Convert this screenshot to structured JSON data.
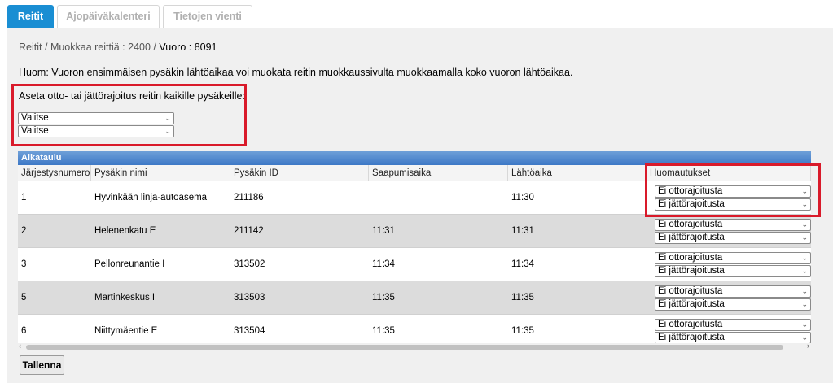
{
  "tabs": [
    {
      "label": "Reitit",
      "active": true
    },
    {
      "label": "Ajopäiväkalenteri",
      "active": false
    },
    {
      "label": "Tietojen vienti",
      "active": false
    }
  ],
  "breadcrumb": {
    "root": "Reitit",
    "sep": "/",
    "edit": "Muokkaa reittiä : 2400",
    "current": "Vuoro : 8091"
  },
  "note": "Huom: Vuoron ensimmäisen pysäkin lähtöaikaa voi muokata reitin muokkaussivulta muokkaamalla koko vuoron lähtöaikaa.",
  "restriction": {
    "label": "Aseta otto- tai jättörajoitus reitin kaikille pysäkeille:",
    "select1": "Valitse",
    "select2": "Valitse"
  },
  "grid": {
    "caption": "Aikataulu",
    "headers": [
      "Järjestysnumero",
      "Pysäkin nimi",
      "Pysäkin ID",
      "Saapumisaika",
      "Lähtöaika",
      "Huomautukset"
    ],
    "rows": [
      {
        "seq": "1",
        "name": "Hyvinkään linja-autoasema",
        "id": "211186",
        "arrival": "",
        "departure": "11:30",
        "pickup": "Ei ottorajoitusta",
        "dropoff": "Ei jättörajoitusta"
      },
      {
        "seq": "2",
        "name": "Helenenkatu E",
        "id": "211142",
        "arrival": "11:31",
        "departure": "11:31",
        "pickup": "Ei ottorajoitusta",
        "dropoff": "Ei jättörajoitusta"
      },
      {
        "seq": "3",
        "name": "Pellonreunantie I",
        "id": "313502",
        "arrival": "11:34",
        "departure": "11:34",
        "pickup": "Ei ottorajoitusta",
        "dropoff": "Ei jättörajoitusta"
      },
      {
        "seq": "5",
        "name": "Martinkeskus I",
        "id": "313503",
        "arrival": "11:35",
        "departure": "11:35",
        "pickup": "Ei ottorajoitusta",
        "dropoff": "Ei jättörajoitusta"
      },
      {
        "seq": "6",
        "name": "Niittymäentie E",
        "id": "313504",
        "arrival": "11:35",
        "departure": "11:35",
        "pickup": "Ei ottorajoitusta",
        "dropoff": "Ei jättörajoitusta"
      }
    ]
  },
  "save_label": "Tallenna",
  "colors": {
    "accent": "#1a8ed3",
    "highlight": "#d91a2a",
    "caption": "#3d78c6"
  },
  "icons": {
    "select_arrow": "chevron-down-icon",
    "scroll_left": "chevron-left-icon",
    "scroll_right": "chevron-right-icon"
  }
}
